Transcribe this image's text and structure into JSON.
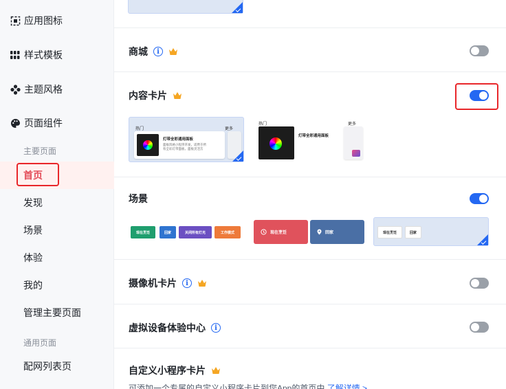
{
  "sidebar": {
    "top_items": [
      {
        "label": "应用图标",
        "icon": "app-icon"
      },
      {
        "label": "样式模板",
        "icon": "grid-icon"
      },
      {
        "label": "主题风格",
        "icon": "theme-icon"
      },
      {
        "label": "页面组件",
        "icon": "palette-icon"
      }
    ],
    "group_main": "主要页面",
    "main_pages": [
      "首页",
      "发现",
      "场景",
      "体验",
      "我的",
      "管理主要页面"
    ],
    "group_common": "通用页面",
    "common_pages": [
      "配网列表页"
    ],
    "active": "首页"
  },
  "sections": {
    "mall": {
      "title": "商城",
      "enabled": false
    },
    "content_card": {
      "title": "内容卡片",
      "enabled": true,
      "preview": {
        "hot_label": "热门",
        "more_label": "更多",
        "card_title": "灯带全彩通用面板",
        "card_desc_1": "面板风格小程序开发，适用于所",
        "card_desc_2": "有全彩灯带面板，面板灵活方"
      }
    },
    "scene": {
      "title": "场景",
      "enabled": true,
      "chips_a": [
        "现在烹饪",
        "回家",
        "关闭所有灯光",
        "工作模式"
      ],
      "chips_b": [
        "现在烹饪",
        "回家"
      ],
      "chips_c": [
        "现在烹饪",
        "回家"
      ]
    },
    "camera_card": {
      "title": "摄像机卡片",
      "enabled": false
    },
    "virtual_center": {
      "title": "虚拟设备体验中心",
      "enabled": false
    },
    "custom_miniapp": {
      "title": "自定义小程序卡片",
      "desc": "可添加一个专属的自定义小程序卡片到您App的首页中",
      "link": "了解详情 >"
    }
  },
  "colors": {
    "primary": "#2468f2",
    "active_red": "#e34d59",
    "highlight": "#e8262a",
    "crown": "#f5a623",
    "chip_green": "#1f9e6e",
    "chip_blue": "#2f74d0",
    "chip_purple": "#6b4fc2",
    "chip_orange": "#ee7a3a",
    "scene_red": "#e0525c",
    "scene_blue": "#4a6fa5"
  }
}
